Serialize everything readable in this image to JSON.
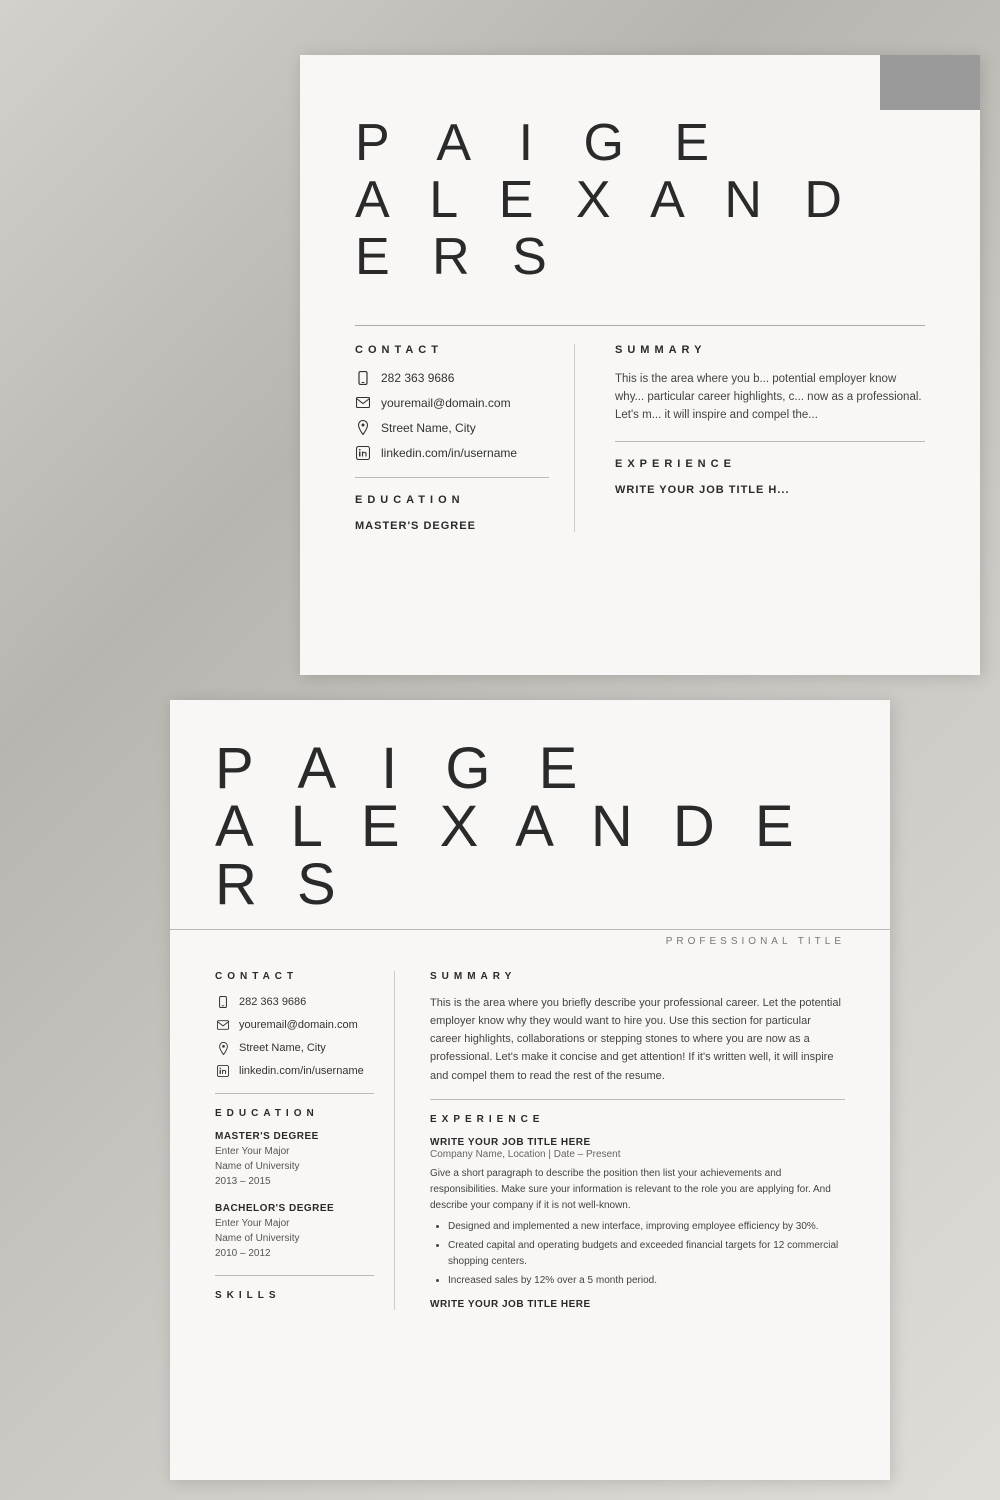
{
  "background": {
    "color": "#c8c8c8"
  },
  "top_card": {
    "name_line1": "P A I G E",
    "name_line2": "A L E X A N D E R S",
    "contact": {
      "label": "CONTACT",
      "phone": "282 363 9686",
      "email": "youremail@domain.com",
      "address": "Street Name, City",
      "linkedin": "linkedin.com/in/username"
    },
    "education": {
      "label": "EDUCATION",
      "degree1_title": "MASTER'S DEGREE"
    },
    "summary": {
      "label": "SUMMARY",
      "text": "This is the area where you b... potential employer know why... particular career highlights, c... now as a professional. Let's m... it will inspire and compel the..."
    },
    "experience": {
      "label": "EXPERIENCE",
      "job1_title": "WRITE YOUR JOB TITLE H..."
    }
  },
  "bottom_card": {
    "name_line1": "P A I G E",
    "name_line2": "A L E X A N D E R S",
    "professional_title": "PROFESSIONAL TITLE",
    "contact": {
      "label": "CONTACT",
      "phone": "282 363 9686",
      "email": "youremail@domain.com",
      "address": "Street Name, City",
      "linkedin": "linkedin.com/in/username"
    },
    "education": {
      "label": "EDUCATION",
      "degree1_title": "MASTER'S DEGREE",
      "degree1_major": "Enter Your Major",
      "degree1_university": "Name of University",
      "degree1_years": "2013 – 2015",
      "degree2_title": "BACHELOR'S DEGREE",
      "degree2_major": "Enter Your Major",
      "degree2_university": "Name of University",
      "degree2_years": "2010 – 2012"
    },
    "skills_label": "SKILLS",
    "summary": {
      "label": "SUMMARY",
      "text": "This is the area where you briefly describe your professional career. Let the potential employer know why they would want to hire you. Use this section for particular career highlights, collaborations or stepping stones to where you are now as a professional. Let's make it concise and get attention! If it's written well, it will inspire and compel them to read the rest of the resume."
    },
    "experience": {
      "label": "EXPERIENCE",
      "job1_title": "WRITE YOUR JOB TITLE HERE",
      "job1_company": "Company Name, Location | Date – Present",
      "job1_desc": "Give a short paragraph to describe the position then list your achievements and responsibilities. Make sure your information is relevant to the role you are applying for. And describe your company if it is not well-known.",
      "job1_bullet1": "Designed and implemented a new interface, improving employee efficiency by 30%.",
      "job1_bullet2": "Created capital and operating budgets and exceeded financial targets for 12 commercial shopping centers.",
      "job1_bullet3": "Increased sales by 12% over a 5 month period.",
      "job2_title": "WRITE YOUR JOB TITLE HERE"
    }
  }
}
